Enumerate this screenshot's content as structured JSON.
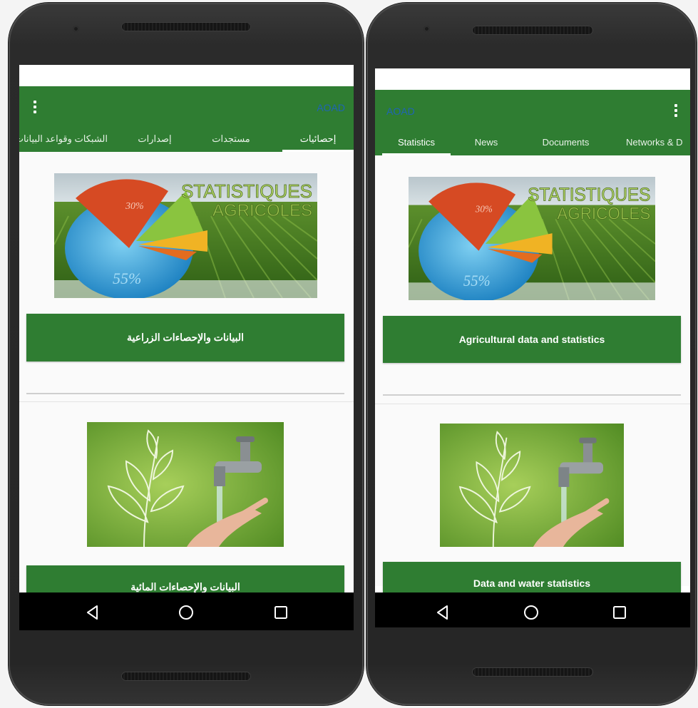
{
  "left_phone": {
    "app_title": "AOAD",
    "tabs": [
      "إحصائيات",
      "مستجدات",
      "إصدارات",
      "الشبكات وقواعد البيانات"
    ],
    "cards": [
      {
        "image_text_main": "STATISTIQUES",
        "image_text_sub": "AGRICOLES",
        "pie_label_a": "30%",
        "pie_label_b": "55%",
        "button_label": "البيانات والإحصاءات الزراعية"
      },
      {
        "button_label": "البيانات والإحصاءات المائية"
      }
    ]
  },
  "right_phone": {
    "app_title": "AOAD",
    "tabs": [
      "Statistics",
      "News",
      "Documents",
      "Networks & D"
    ],
    "cards": [
      {
        "image_text_main": "STATISTIQUES",
        "image_text_sub": "AGRICOLES",
        "pie_label_a": "30%",
        "pie_label_b": "55%",
        "button_label": "Agricultural data and statistics"
      },
      {
        "button_label": "Data and water statistics"
      }
    ]
  },
  "icons": [
    "more-vert-icon",
    "back-icon",
    "home-icon",
    "recents-icon"
  ],
  "colors": {
    "toolbar": "#2f7d32",
    "title": "#1f64b5",
    "navbar": "#000000"
  }
}
